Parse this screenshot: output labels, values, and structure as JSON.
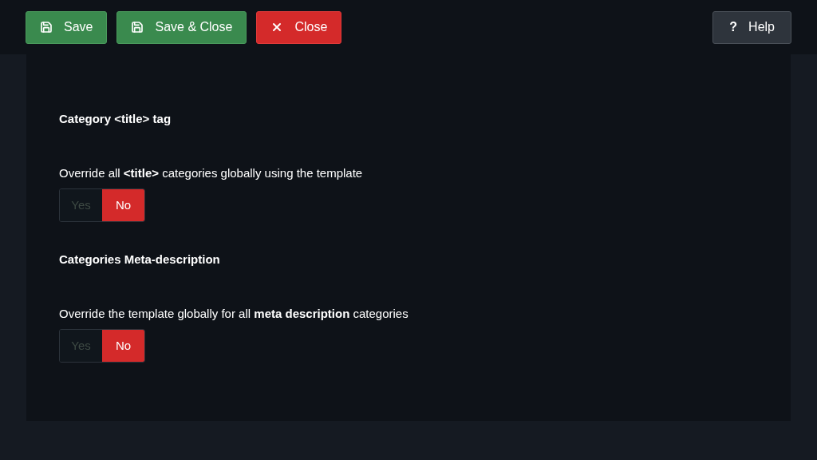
{
  "toolbar": {
    "buttons": [
      {
        "label": "Save",
        "kind": "save"
      },
      {
        "label": "Save & Close",
        "kind": "save"
      },
      {
        "label": "Close",
        "kind": "close"
      }
    ],
    "help": {
      "label": "Help",
      "glyph": "?"
    }
  },
  "sections": [
    {
      "heading": "Category <title> tag",
      "field": {
        "label": "Override all **<title>** categories globally using the template",
        "options": [
          {
            "label": "Yes",
            "selected": false
          },
          {
            "label": "No",
            "selected": true
          }
        ]
      }
    },
    {
      "heading": "Categories Meta-description",
      "field": {
        "label": "Override the template globally for all **meta description** categories",
        "options": [
          {
            "label": "Yes",
            "selected": false
          },
          {
            "label": "No",
            "selected": true
          }
        ]
      }
    }
  ]
}
